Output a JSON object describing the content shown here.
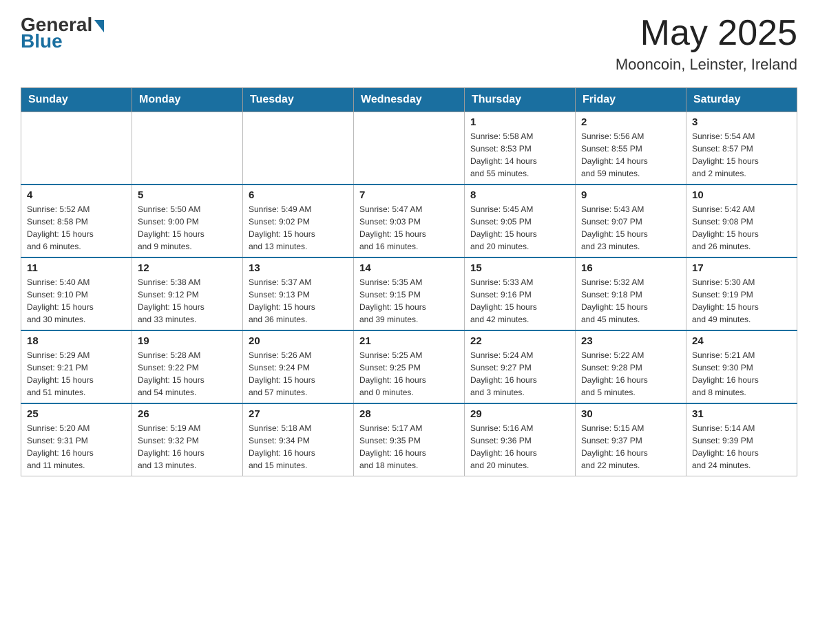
{
  "header": {
    "logo": {
      "general": "General",
      "blue": "Blue"
    },
    "title": "May 2025",
    "location": "Mooncoin, Leinster, Ireland"
  },
  "weekdays": [
    "Sunday",
    "Monday",
    "Tuesday",
    "Wednesday",
    "Thursday",
    "Friday",
    "Saturday"
  ],
  "weeks": [
    [
      {
        "day": "",
        "info": ""
      },
      {
        "day": "",
        "info": ""
      },
      {
        "day": "",
        "info": ""
      },
      {
        "day": "",
        "info": ""
      },
      {
        "day": "1",
        "info": "Sunrise: 5:58 AM\nSunset: 8:53 PM\nDaylight: 14 hours\nand 55 minutes."
      },
      {
        "day": "2",
        "info": "Sunrise: 5:56 AM\nSunset: 8:55 PM\nDaylight: 14 hours\nand 59 minutes."
      },
      {
        "day": "3",
        "info": "Sunrise: 5:54 AM\nSunset: 8:57 PM\nDaylight: 15 hours\nand 2 minutes."
      }
    ],
    [
      {
        "day": "4",
        "info": "Sunrise: 5:52 AM\nSunset: 8:58 PM\nDaylight: 15 hours\nand 6 minutes."
      },
      {
        "day": "5",
        "info": "Sunrise: 5:50 AM\nSunset: 9:00 PM\nDaylight: 15 hours\nand 9 minutes."
      },
      {
        "day": "6",
        "info": "Sunrise: 5:49 AM\nSunset: 9:02 PM\nDaylight: 15 hours\nand 13 minutes."
      },
      {
        "day": "7",
        "info": "Sunrise: 5:47 AM\nSunset: 9:03 PM\nDaylight: 15 hours\nand 16 minutes."
      },
      {
        "day": "8",
        "info": "Sunrise: 5:45 AM\nSunset: 9:05 PM\nDaylight: 15 hours\nand 20 minutes."
      },
      {
        "day": "9",
        "info": "Sunrise: 5:43 AM\nSunset: 9:07 PM\nDaylight: 15 hours\nand 23 minutes."
      },
      {
        "day": "10",
        "info": "Sunrise: 5:42 AM\nSunset: 9:08 PM\nDaylight: 15 hours\nand 26 minutes."
      }
    ],
    [
      {
        "day": "11",
        "info": "Sunrise: 5:40 AM\nSunset: 9:10 PM\nDaylight: 15 hours\nand 30 minutes."
      },
      {
        "day": "12",
        "info": "Sunrise: 5:38 AM\nSunset: 9:12 PM\nDaylight: 15 hours\nand 33 minutes."
      },
      {
        "day": "13",
        "info": "Sunrise: 5:37 AM\nSunset: 9:13 PM\nDaylight: 15 hours\nand 36 minutes."
      },
      {
        "day": "14",
        "info": "Sunrise: 5:35 AM\nSunset: 9:15 PM\nDaylight: 15 hours\nand 39 minutes."
      },
      {
        "day": "15",
        "info": "Sunrise: 5:33 AM\nSunset: 9:16 PM\nDaylight: 15 hours\nand 42 minutes."
      },
      {
        "day": "16",
        "info": "Sunrise: 5:32 AM\nSunset: 9:18 PM\nDaylight: 15 hours\nand 45 minutes."
      },
      {
        "day": "17",
        "info": "Sunrise: 5:30 AM\nSunset: 9:19 PM\nDaylight: 15 hours\nand 49 minutes."
      }
    ],
    [
      {
        "day": "18",
        "info": "Sunrise: 5:29 AM\nSunset: 9:21 PM\nDaylight: 15 hours\nand 51 minutes."
      },
      {
        "day": "19",
        "info": "Sunrise: 5:28 AM\nSunset: 9:22 PM\nDaylight: 15 hours\nand 54 minutes."
      },
      {
        "day": "20",
        "info": "Sunrise: 5:26 AM\nSunset: 9:24 PM\nDaylight: 15 hours\nand 57 minutes."
      },
      {
        "day": "21",
        "info": "Sunrise: 5:25 AM\nSunset: 9:25 PM\nDaylight: 16 hours\nand 0 minutes."
      },
      {
        "day": "22",
        "info": "Sunrise: 5:24 AM\nSunset: 9:27 PM\nDaylight: 16 hours\nand 3 minutes."
      },
      {
        "day": "23",
        "info": "Sunrise: 5:22 AM\nSunset: 9:28 PM\nDaylight: 16 hours\nand 5 minutes."
      },
      {
        "day": "24",
        "info": "Sunrise: 5:21 AM\nSunset: 9:30 PM\nDaylight: 16 hours\nand 8 minutes."
      }
    ],
    [
      {
        "day": "25",
        "info": "Sunrise: 5:20 AM\nSunset: 9:31 PM\nDaylight: 16 hours\nand 11 minutes."
      },
      {
        "day": "26",
        "info": "Sunrise: 5:19 AM\nSunset: 9:32 PM\nDaylight: 16 hours\nand 13 minutes."
      },
      {
        "day": "27",
        "info": "Sunrise: 5:18 AM\nSunset: 9:34 PM\nDaylight: 16 hours\nand 15 minutes."
      },
      {
        "day": "28",
        "info": "Sunrise: 5:17 AM\nSunset: 9:35 PM\nDaylight: 16 hours\nand 18 minutes."
      },
      {
        "day": "29",
        "info": "Sunrise: 5:16 AM\nSunset: 9:36 PM\nDaylight: 16 hours\nand 20 minutes."
      },
      {
        "day": "30",
        "info": "Sunrise: 5:15 AM\nSunset: 9:37 PM\nDaylight: 16 hours\nand 22 minutes."
      },
      {
        "day": "31",
        "info": "Sunrise: 5:14 AM\nSunset: 9:39 PM\nDaylight: 16 hours\nand 24 minutes."
      }
    ]
  ]
}
